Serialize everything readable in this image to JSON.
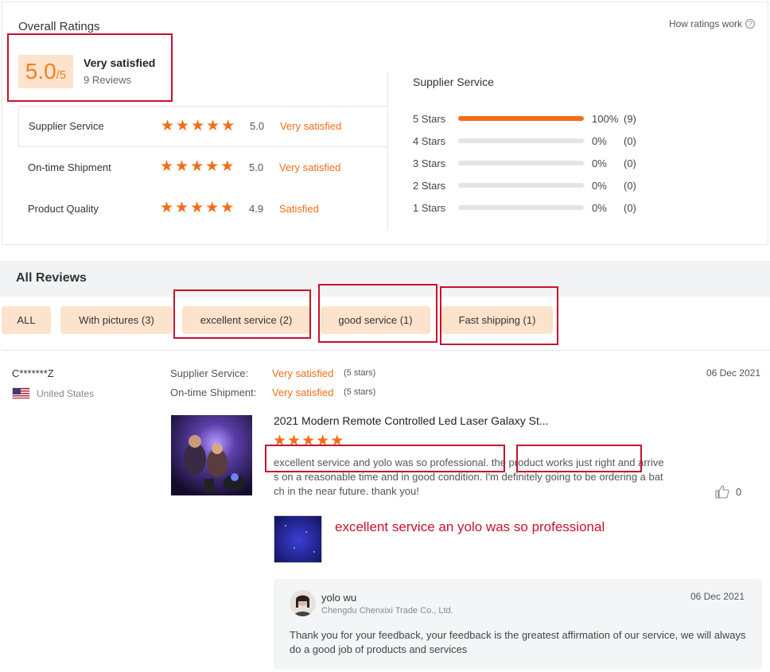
{
  "overall": {
    "title": "Overall Ratings",
    "how_link": "How ratings work",
    "score": "5.0",
    "score_max": "/5",
    "verdict": "Very satisfied",
    "reviews": "9 Reviews"
  },
  "categories": [
    {
      "name": "Supplier Service",
      "rating": 5,
      "score": "5.0",
      "label": "Very satisfied"
    },
    {
      "name": "On-time Shipment",
      "rating": 5,
      "score": "5.0",
      "label": "Very satisfied"
    },
    {
      "name": "Product Quality",
      "rating": 4.9,
      "score": "4.9",
      "label": "Satisfied"
    }
  ],
  "supplier_service": {
    "title": "Supplier Service",
    "bars": [
      {
        "label": "5  Stars",
        "fraction": 1.0,
        "pct": "100%",
        "count": "(9)"
      },
      {
        "label": "4  Stars",
        "fraction": 0,
        "pct": "0%",
        "count": "(0)"
      },
      {
        "label": "3  Stars",
        "fraction": 0,
        "pct": "0%",
        "count": "(0)"
      },
      {
        "label": "2  Stars",
        "fraction": 0,
        "pct": "0%",
        "count": "(0)"
      },
      {
        "label": "1  Stars",
        "fraction": 0,
        "pct": "0%",
        "count": "(0)"
      }
    ]
  },
  "all_reviews": {
    "title": "All Reviews",
    "filters": [
      "ALL",
      "With pictures (3)",
      "excellent service (2)",
      "good service (1)",
      "Fast shipping (1)"
    ]
  },
  "review": {
    "name": "C*******Z",
    "country": "United States",
    "date": "06 Dec 2021",
    "supplier_service_key": "Supplier Service:",
    "supplier_service_val": "Very satisfied",
    "supplier_service_stars": "(5 stars)",
    "shipment_key": "On-time Shipment:",
    "shipment_val": "Very satisfied",
    "shipment_stars": "(5 stars)",
    "product_title": "2021 Modern Remote Controlled Led Laser Galaxy St...",
    "rating": 5,
    "text": "excellent service and yolo was so professional. the product works just right and arrives on a reasonable time and in good condition. I'm definitely going to be ordering a batch in the near future. thank you!",
    "likes": "0",
    "annotation": "excellent service an yolo was so professional"
  },
  "reply": {
    "name": "yolo wu",
    "company": "Chengdu Chenxixi Trade Co., Ltd.",
    "date": "06 Dec 2021",
    "text": "Thank you for your feedback, your feedback is the greatest affirmation of our service, we will always do a good job of products and services"
  },
  "colors": {
    "accent": "#f36c17",
    "chip_bg": "#fde3cc",
    "highlight": "#c8102e"
  }
}
